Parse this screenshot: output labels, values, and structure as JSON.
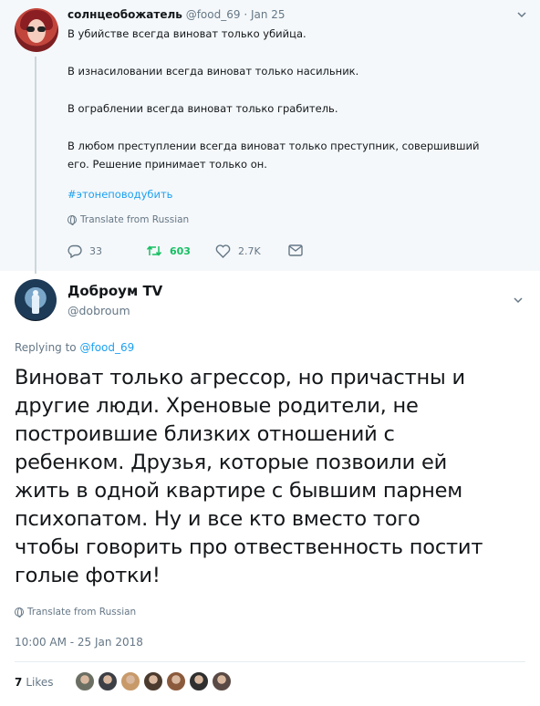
{
  "parent_tweet": {
    "name": "солнцеобожатель",
    "handle": "@food_69",
    "separator": "·",
    "date": "Jan 25",
    "paragraphs": [
      [
        "В убийстве всегда виноват только убийца."
      ],
      [
        "В изнасиловании всегда виноват только насильник."
      ],
      [
        "В ограблении всегда виноват только грабитель."
      ],
      [
        "В любом преступлении всегда виноват только преступник, совершивший",
        "его. Решение принимает только он."
      ]
    ],
    "hashtag": "#этонеповодубить",
    "translate_label": "Translate from Russian",
    "actions": {
      "replies": "33",
      "retweets": "603",
      "likes": "2.7K"
    }
  },
  "main_tweet": {
    "name": "Доброум TV",
    "handle": "@dobroum",
    "replying_prefix": "Replying to",
    "replying_to": "@food_69",
    "text_lines": [
      "Виноват только агрессор, но причастны и",
      "другие люди. Хреновые родители, не",
      "построившие близких отношений с",
      "ребенком. Друзья, которые позвоили ей",
      "жить в одной квартире с бывшим парнем",
      "психопатом. Ну и все кто вместо того",
      "чтобы говорить про отвественность постит",
      "голые фотки!"
    ],
    "translate_label": "Translate from Russian",
    "timestamp": "10:00 AM - 25 Jan 2018",
    "likes_count": "7",
    "likes_label": "Likes",
    "liker_colors": [
      "#6b6f63",
      "#3c3f45",
      "#c89a6a",
      "#4b3b2e",
      "#8b5a3c",
      "#2f2f2f",
      "#5a4a45"
    ]
  },
  "colors": {
    "accent": "#1da1f2",
    "retweet": "#17bf63",
    "muted": "#657786",
    "parent_bg": "#f5f8fa"
  }
}
